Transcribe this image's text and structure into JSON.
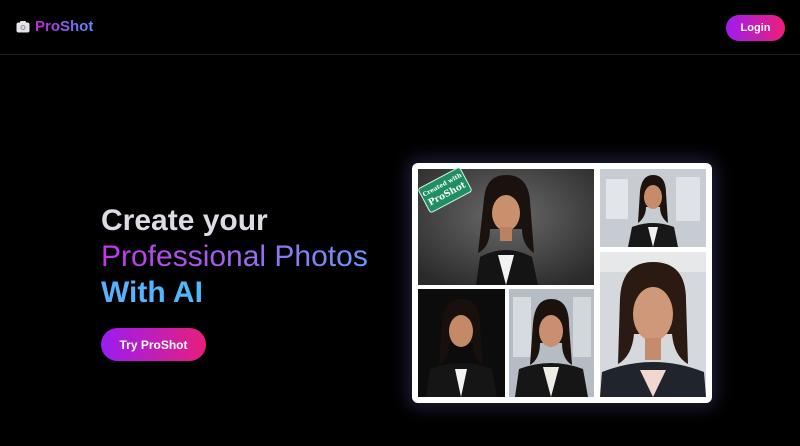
{
  "navbar": {
    "brand_name": "ProShot",
    "brand_icon": "camera-icon",
    "login_label": "Login"
  },
  "hero": {
    "line1": "Create your",
    "line2": "Professional Photos",
    "line3": "With AI",
    "cta_label": "Try ProShot"
  },
  "gallery": {
    "badge_line1": "Created with",
    "badge_line2": "ProShot"
  },
  "colors": {
    "background": "#000000",
    "brand_gradient_start": "#c026d3",
    "brand_gradient_end": "#5b8cff",
    "button_gradient_start": "#9a1df2",
    "button_gradient_end": "#e81e7c",
    "badge": "#1f8f63"
  }
}
